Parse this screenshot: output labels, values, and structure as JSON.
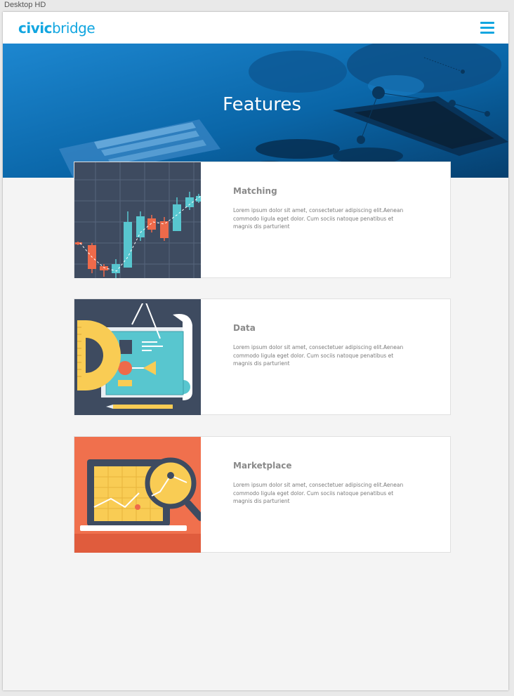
{
  "artboard": {
    "label": "Desktop HD"
  },
  "header": {
    "logo_bold": "civic",
    "logo_light": "bridge",
    "menu_icon": "hamburger-menu-icon"
  },
  "hero": {
    "title": "Features"
  },
  "features": [
    {
      "title": "Matching",
      "description": "Lorem ipsum dolor sit amet, consectetuer adipiscing elit.Aenean commodo ligula eget dolor. Cum sociis natoque penatibus et magnis dis parturient",
      "icon": "candlestick-chart-illustration"
    },
    {
      "title": "Data",
      "description": "Lorem ipsum dolor sit amet, consectetuer adipiscing elit.Aenean commodo ligula eget dolor. Cum sociis natoque penatibus et magnis dis parturient",
      "icon": "blueprint-drafting-illustration"
    },
    {
      "title": "Marketplace",
      "description": "Lorem ipsum dolor sit amet, consectetuer adipiscing elit.Aenean commodo ligula eget dolor. Cum sociis natoque penatibus et magnis dis parturient",
      "icon": "laptop-magnifier-illustration"
    }
  ],
  "colors": {
    "brand": "#12a6e0",
    "hero_blue": "#0b5d9a",
    "card_dark": "#3e4b60",
    "accent_teal": "#58c6cf",
    "accent_orange": "#ee6a4a",
    "accent_yellow": "#f9cc54"
  }
}
